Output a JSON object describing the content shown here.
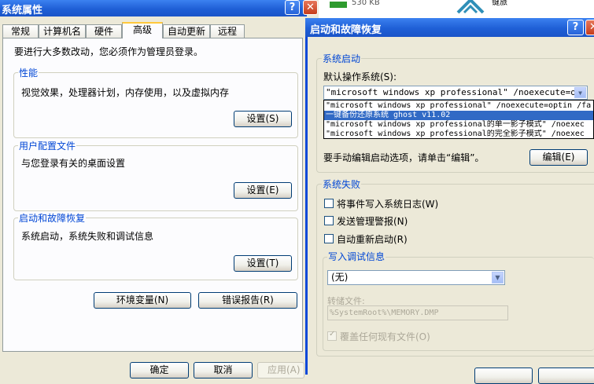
{
  "left_window": {
    "title": "系统属性",
    "tabs": [
      "常规",
      "计算机名",
      "硬件",
      "高级",
      "自动更新",
      "远程"
    ],
    "active_tab": "高级",
    "admin_note": "要进行大多数改动，您必须作为管理员登录。",
    "performance": {
      "title": "性能",
      "desc": "视觉效果，处理器计划，内存使用，以及虚拟内存",
      "button": "设置(S)"
    },
    "user_profiles": {
      "title": "用户配置文件",
      "desc": "与您登录有关的桌面设置",
      "button": "设置(E)"
    },
    "startup_recovery": {
      "title": "启动和故障恢复",
      "desc": "系统启动，系统失败和调试信息",
      "button": "设置(T)"
    },
    "env_button": "环境变量(N)",
    "error_button": "错误报告(R)",
    "ok": "确定",
    "cancel": "取消",
    "apply": "应用(A)"
  },
  "background": {
    "file_size": "530 KB",
    "partial_text": "键旅"
  },
  "right_window": {
    "title": "启动和故障恢复",
    "system_startup": {
      "title": "系统启动",
      "default_os_label": "默认操作系统(S):",
      "selected": "\"microsoft windows xp professional\" /noexecute=optin",
      "options": [
        "\"microsoft windows xp professional\" /noexecute=optin /fa",
        "一键备份还原系统 ghost v11.02",
        "\"microsoft windows xp professional的单一影子模式\" /noexec",
        "\"microsoft windows xp professional的完全影子模式\" /noexec"
      ],
      "highlighted_index": 1,
      "edit_hint": "要手动编辑启动选项，请单击“编辑”。",
      "edit_button": "编辑(E)"
    },
    "system_failure": {
      "title": "系统失败",
      "log_event": "将事件写入系统日志(W)",
      "send_alert": "发送管理警报(N)",
      "auto_restart": "自动重新启动(R)",
      "debug_title": "写入调试信息",
      "debug_select": "(无)",
      "dump_label": "转储文件:",
      "dump_path": "%SystemRoot%\\MEMORY.DMP",
      "overwrite": "覆盖任何现有文件(O)"
    }
  }
}
